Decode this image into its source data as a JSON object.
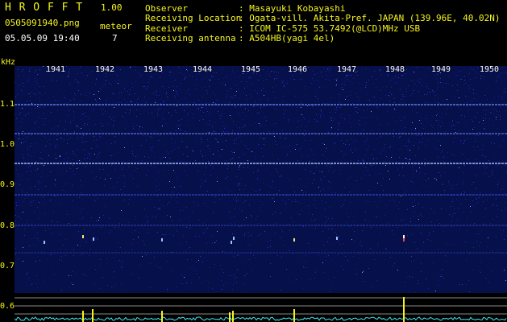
{
  "app": {
    "title": "H R O F F T",
    "version": "1.00"
  },
  "file": {
    "name": "0505091940.png",
    "datetime": "05.05.09 19:40"
  },
  "meteor": {
    "label": "meteor",
    "count": "7"
  },
  "info": [
    {
      "key": "Observer",
      "value": ": Masayuki Kobayashi"
    },
    {
      "key": "Receiving Location",
      "value": ": Ogata-vill. Akita-Pref. JAPAN (139.96E, 40.02N)"
    },
    {
      "key": "Receiver",
      "value": ": ICOM IC-575 53.7492(@LCD)MHz USB"
    },
    {
      "key": "Receiving antenna",
      "value": ": A504HB(yagi 4el)"
    }
  ],
  "axis": {
    "unit": "kHz",
    "y_ticks": [
      "1.1",
      "1.0",
      "0.9",
      "0.8",
      "0.7",
      "0.6"
    ],
    "x_ticks": [
      "1941",
      "1942",
      "1943",
      "1944",
      "1945",
      "1946",
      "1947",
      "1948",
      "1949",
      "1950"
    ]
  },
  "colors": {
    "label": "#f5f51e",
    "background": "#000000",
    "noise": "#1b2aa8",
    "trace": "#43e6ee"
  }
}
